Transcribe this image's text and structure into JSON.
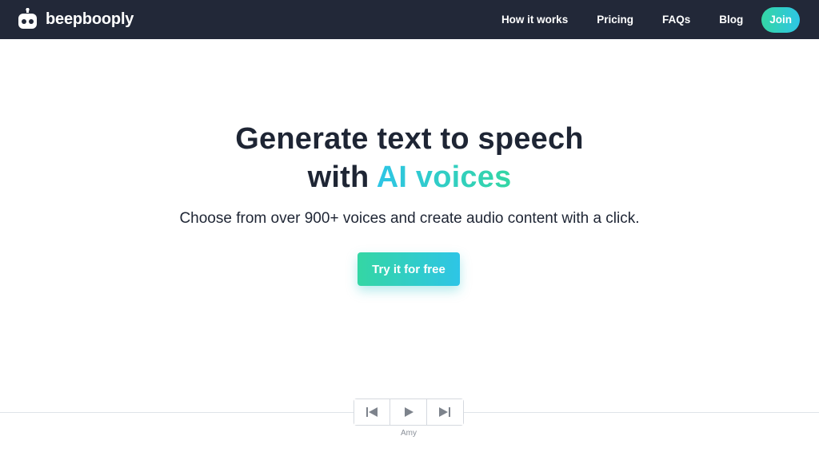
{
  "brand": {
    "name": "beepbooply",
    "logo_icon": "robot-icon"
  },
  "nav": {
    "links": [
      "How it works",
      "Pricing",
      "FAQs",
      "Blog"
    ],
    "join_label": "Join"
  },
  "hero": {
    "title_line1": "Generate text to speech",
    "title_line2_prefix": "with ",
    "title_line2_accent": "AI voices",
    "subtitle": "Choose from over 900+ voices and create audio content with a click.",
    "cta_label": "Try it for free"
  },
  "player": {
    "controls": [
      "skip-previous-icon",
      "play-icon",
      "skip-next-icon"
    ],
    "voice_name": "Amy"
  },
  "colors": {
    "nav_bg": "#222838",
    "accent_green": "#34d6a4",
    "accent_cyan": "#2ec5e6",
    "text_dark": "#1e2534"
  }
}
